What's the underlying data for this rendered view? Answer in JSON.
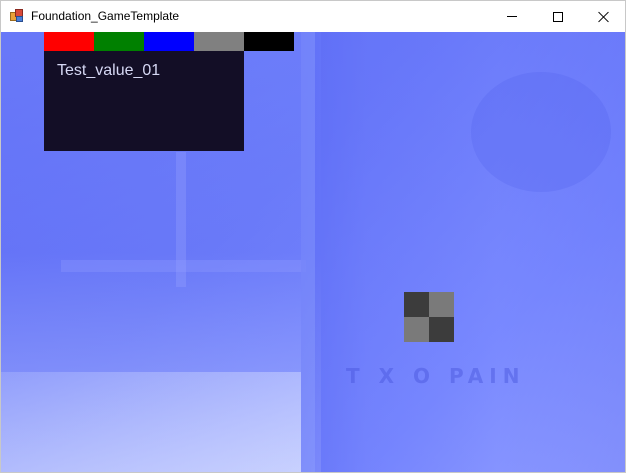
{
  "window": {
    "title": "Foundation_GameTemplate",
    "icon": "app-icon",
    "controls": {
      "minimize_icon": "minimize-icon",
      "maximize_icon": "maximize-icon",
      "close_icon": "close-icon"
    }
  },
  "viewport": {
    "background_tint": "#6a78f8",
    "background_paint_text": "T X O PAIN",
    "color_swatches": [
      {
        "name": "red",
        "color": "#ff0000"
      },
      {
        "name": "green",
        "color": "#008000"
      },
      {
        "name": "blue",
        "color": "#0000ff"
      },
      {
        "name": "gray",
        "color": "#808080"
      },
      {
        "name": "black",
        "color": "#000000"
      }
    ],
    "debug_panel": {
      "text": "Test_value_01",
      "background": "#130e26",
      "text_color": "#d6d8f4"
    },
    "checker_tile": {
      "colors": [
        "#3c3c3c",
        "#7a7a7a",
        "#7a7a7a",
        "#3c3c3c"
      ]
    }
  }
}
